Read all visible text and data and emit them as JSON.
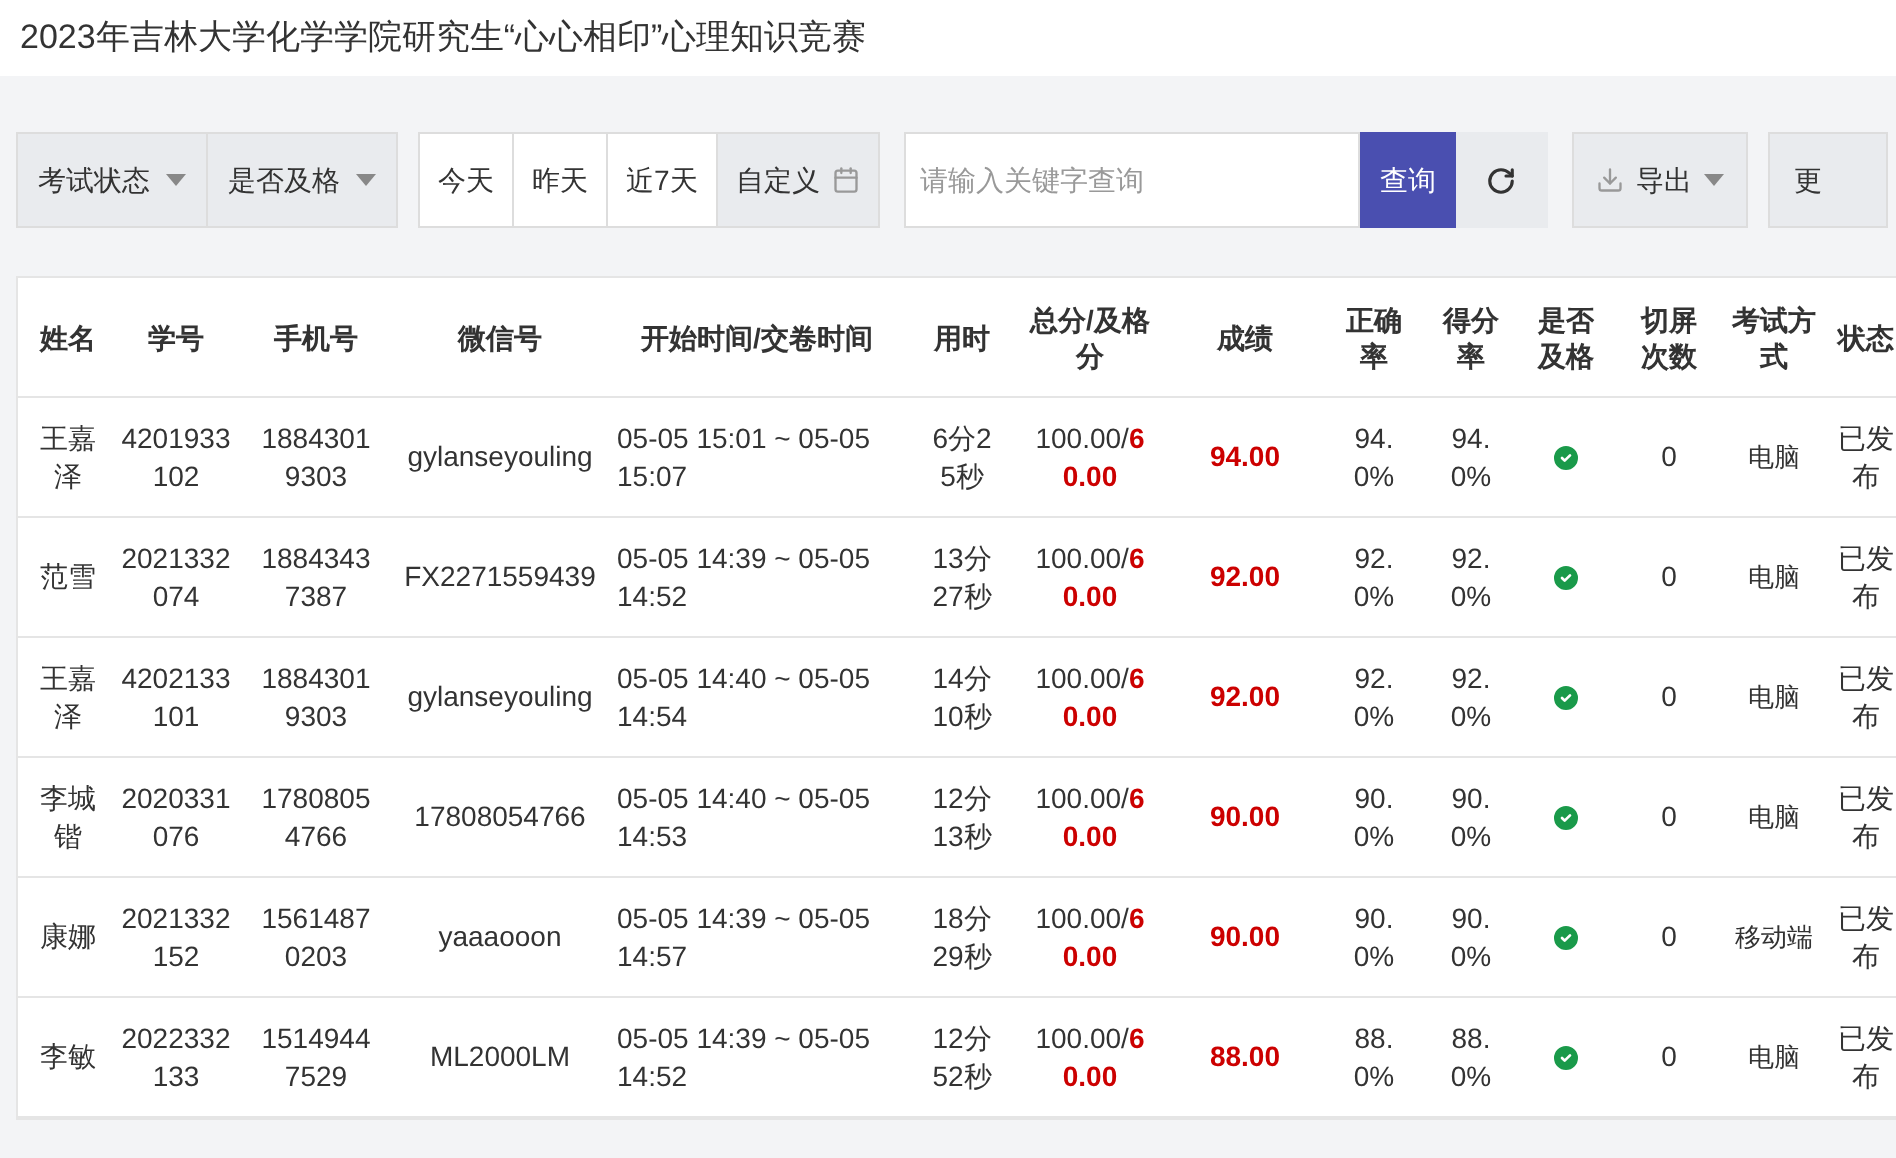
{
  "title": "2023年吉林大学化学学院研究生“心心相印”心理知识竞赛",
  "filters": [
    {
      "label": "考试状态"
    },
    {
      "label": "是否及格"
    }
  ],
  "date_ranges": [
    {
      "label": "今天",
      "selected": false
    },
    {
      "label": "昨天",
      "selected": false
    },
    {
      "label": "近7天",
      "selected": false
    },
    {
      "label": "自定义",
      "selected": true
    }
  ],
  "search": {
    "placeholder": "请输入关键字查询",
    "button": "查询"
  },
  "export_button": "导出",
  "more_button": "更",
  "table": {
    "columns": [
      "姓名",
      "学号",
      "手机号",
      "微信号",
      "开始时间/交卷时间",
      "用时",
      "总分/及格分",
      "成绩",
      "正确率",
      "得分率",
      "是否及格",
      "切屏次数",
      "考试方式",
      "状态"
    ],
    "rows": [
      {
        "name": "王嘉泽",
        "student_id": "4201933102",
        "phone": "18843019303",
        "wechat": "gylanseyouling",
        "time": "05-05 15:01 ~ 05-05 15:07",
        "duration": "6分25秒",
        "total": "100.00/",
        "pass_score": "60.00",
        "score": "94.00",
        "accuracy": "94.0%",
        "score_rate": "94.0%",
        "passed": true,
        "switches": "0",
        "method": "电脑",
        "status": "已发布"
      },
      {
        "name": "范雪",
        "student_id": "2021332074",
        "phone": "18843437387",
        "wechat": "FX2271559439",
        "time": "05-05 14:39 ~ 05-05 14:52",
        "duration": "13分27秒",
        "total": "100.00/",
        "pass_score": "60.00",
        "score": "92.00",
        "accuracy": "92.0%",
        "score_rate": "92.0%",
        "passed": true,
        "switches": "0",
        "method": "电脑",
        "status": "已发布"
      },
      {
        "name": "王嘉泽",
        "student_id": "4202133101",
        "phone": "18843019303",
        "wechat": "gylanseyouling",
        "time": "05-05 14:40 ~ 05-05 14:54",
        "duration": "14分10秒",
        "total": "100.00/",
        "pass_score": "60.00",
        "score": "92.00",
        "accuracy": "92.0%",
        "score_rate": "92.0%",
        "passed": true,
        "switches": "0",
        "method": "电脑",
        "status": "已发布"
      },
      {
        "name": "李城锴",
        "student_id": "2020331076",
        "phone": "17808054766",
        "wechat": "17808054766",
        "time": "05-05 14:40 ~ 05-05 14:53",
        "duration": "12分13秒",
        "total": "100.00/",
        "pass_score": "60.00",
        "score": "90.00",
        "accuracy": "90.0%",
        "score_rate": "90.0%",
        "passed": true,
        "switches": "0",
        "method": "电脑",
        "status": "已发布"
      },
      {
        "name": "康娜",
        "student_id": "2021332152",
        "phone": "15614870203",
        "wechat": "yaaaooon",
        "time": "05-05 14:39 ~ 05-05 14:57",
        "duration": "18分29秒",
        "total": "100.00/",
        "pass_score": "60.00",
        "score": "90.00",
        "accuracy": "90.0%",
        "score_rate": "90.0%",
        "passed": true,
        "switches": "0",
        "method": "移动端",
        "status": "已发布"
      },
      {
        "name": "李敏",
        "student_id": "2022332133",
        "phone": "15149447529",
        "wechat": "ML2000LM",
        "time": "05-05 14:39 ~ 05-05 14:52",
        "duration": "12分52秒",
        "total": "100.00/",
        "pass_score": "60.00",
        "score": "88.00",
        "accuracy": "88.0%",
        "score_rate": "88.0%",
        "passed": true,
        "switches": "0",
        "method": "电脑",
        "status": "已发布"
      }
    ]
  }
}
